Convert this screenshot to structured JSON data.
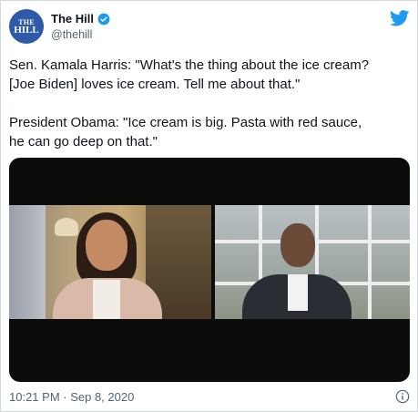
{
  "account": {
    "avatar_line1": "THE",
    "avatar_line2": "HILL",
    "name": "The Hill",
    "handle": "@thehill",
    "verified_icon": "verified-badge-icon",
    "platform_icon": "twitter-bird-icon"
  },
  "tweet": {
    "text": "Sen. Kamala Harris: \"What's the thing about the ice cream?\n[Joe Biden] loves ice cream. Tell me about that.\"\n\nPresident Obama: \"Ice cream is big. Pasta with red sauce,\nhe can go deep on that.\"",
    "timestamp": "10:21 PM · Sep 8, 2020"
  },
  "colors": {
    "brand_blue": "#1d9bf0",
    "avatar_blue": "#2f5aa8",
    "muted_text": "#536471"
  }
}
